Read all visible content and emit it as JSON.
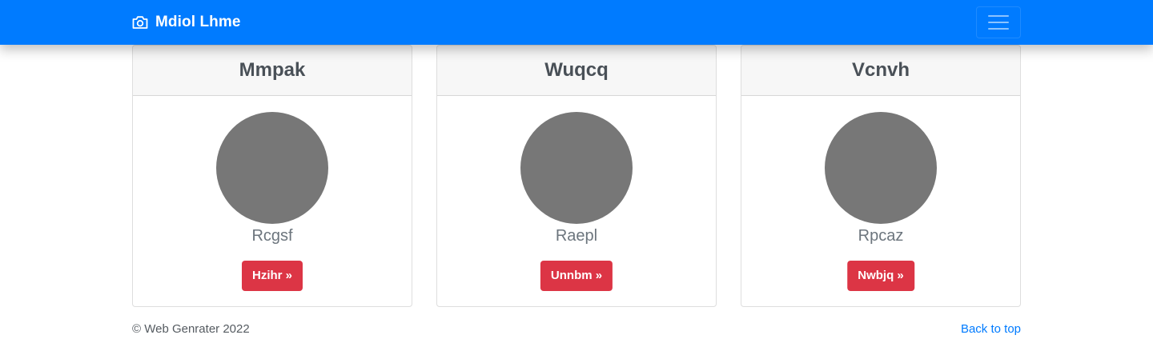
{
  "navbar": {
    "brand_text": "Mdiol Lhme",
    "brand_icon": "camera-icon",
    "toggler_icon": "hamburger-menu-icon",
    "background_color": "#007bff"
  },
  "cards": [
    {
      "title": "Mmpak",
      "subtitle": "Rcgsf",
      "button_label": "Hzihr »"
    },
    {
      "title": "Wuqcq",
      "subtitle": "Raepl",
      "button_label": "Unnbm »"
    },
    {
      "title": "Vcnvh",
      "subtitle": "Rpcaz",
      "button_label": "Nwbjq »"
    }
  ],
  "colors": {
    "button": "#dc3545",
    "avatar_placeholder": "#777777",
    "link": "#007bff"
  },
  "footer": {
    "copyright": "© Web Genrater 2022",
    "back_to_top": "Back to top"
  }
}
